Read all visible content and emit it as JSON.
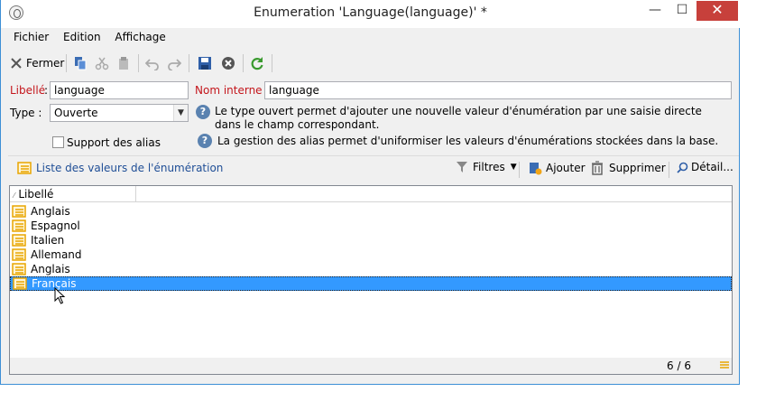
{
  "window": {
    "title": "Enumeration 'Language(language)' *",
    "controls": {
      "minimize": "—",
      "maximize": "☐",
      "close": "✕"
    }
  },
  "menu": [
    "Fichier",
    "Edition",
    "Affichage"
  ],
  "toolbar": {
    "close_label": "Fermer",
    "icons": [
      "close-icon",
      "copy-icon",
      "cut-icon",
      "paste-icon",
      "undo-icon",
      "redo-icon",
      "save-icon",
      "cancel-icon",
      "refresh-icon"
    ]
  },
  "form": {
    "label_field": {
      "label": "Libellé",
      "value": "language"
    },
    "internal_name_field": {
      "label": "Nom interne :",
      "value": "language"
    },
    "type_field": {
      "label": "Type :",
      "value": "Ouverte"
    },
    "type_help": "Le type ouvert permet d'ajouter une nouvelle valeur d'énumération par une saisie directe dans le champ correspondant.",
    "alias_checkbox": {
      "label": "Support des alias",
      "checked": false
    },
    "alias_help": "La gestion des alias permet d'uniformiser les valeurs d'énumérations stockées dans la base."
  },
  "list": {
    "title": "Liste des valeurs de l'énumération",
    "actions": {
      "filters": "Filtres",
      "add": "Ajouter",
      "delete": "Supprimer",
      "detail": "Détail..."
    },
    "column_header": "Libellé",
    "rows": [
      "Anglais",
      "Espagnol",
      "Italien",
      "Allemand",
      "Anglais",
      "Français"
    ],
    "selected_index": 5,
    "counter": "6 / 6"
  },
  "colors": {
    "accent": "#3399ff",
    "label_required": "#c4161c",
    "link_blue": "#1f4e96",
    "close_button": "#c7403b",
    "row_icon": "#e8a500"
  }
}
